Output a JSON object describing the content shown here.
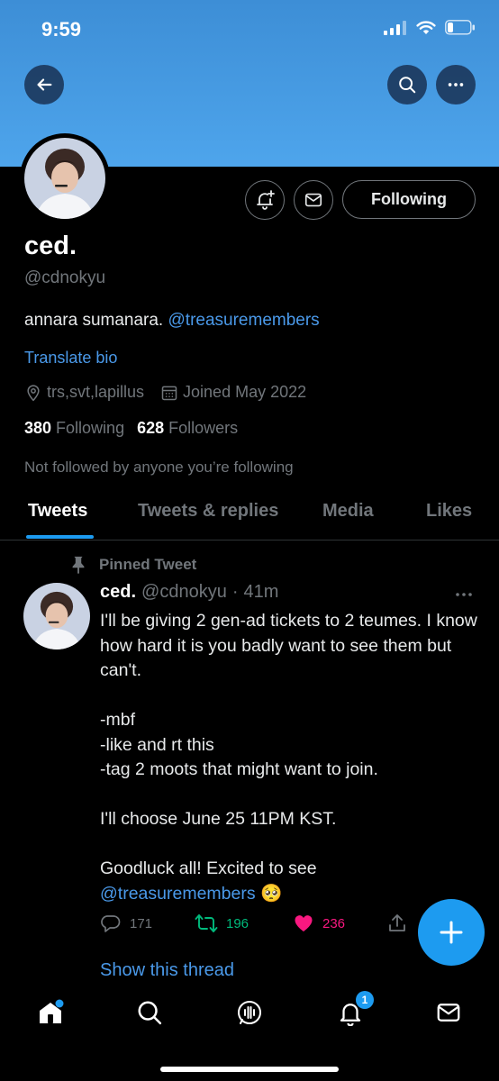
{
  "status": {
    "time": "9:59"
  },
  "profile": {
    "display_name": "ced.",
    "handle": "@cdnokyu",
    "bio_text": "annara sumanara. ",
    "bio_mention": "@treasuremembers",
    "translate_label": "Translate bio",
    "location": "trs,svt,lapillus",
    "joined": "Joined May 2022",
    "following_count": "380",
    "following_label": "Following",
    "followers_count": "628",
    "followers_label": "Followers",
    "not_followed_text": "Not followed by anyone you’re following",
    "following_button": "Following"
  },
  "tabs": [
    {
      "label": "Tweets",
      "active": true
    },
    {
      "label": "Tweets & replies",
      "active": false
    },
    {
      "label": "Media",
      "active": false
    },
    {
      "label": "Likes",
      "active": false
    }
  ],
  "tweet": {
    "pinned_label": "Pinned Tweet",
    "name": "ced.",
    "handle": "@cdnokyu",
    "separator": "·",
    "time": "41m",
    "lines": [
      "I'll be giving 2 gen-ad tickets to 2 teumes. I know how hard it is you badly want to see them but can't.",
      "-mbf",
      "-like and rt this",
      "-tag 2 moots that might want to join.",
      "I'll choose June 25 11PM KST.",
      "Goodluck all! Excited to see"
    ],
    "mention": "@treasuremembers",
    "emoji": "🥺",
    "replies": "171",
    "retweets": "196",
    "likes": "236",
    "show_thread": "Show this thread"
  },
  "notifications_badge": "1",
  "colors": {
    "accent": "#1d9bf0",
    "retweet": "#00ba7c",
    "like": "#f91880",
    "banner": "#4ea5ec"
  },
  "icons": [
    "back-arrow-icon",
    "search-icon",
    "more-icon",
    "add-notification-icon",
    "mail-icon",
    "location-icon",
    "calendar-icon",
    "pin-icon",
    "reply-icon",
    "retweet-icon",
    "heart-icon",
    "share-icon",
    "compose-plus-icon",
    "home-icon",
    "spaces-icon",
    "bell-icon"
  ]
}
